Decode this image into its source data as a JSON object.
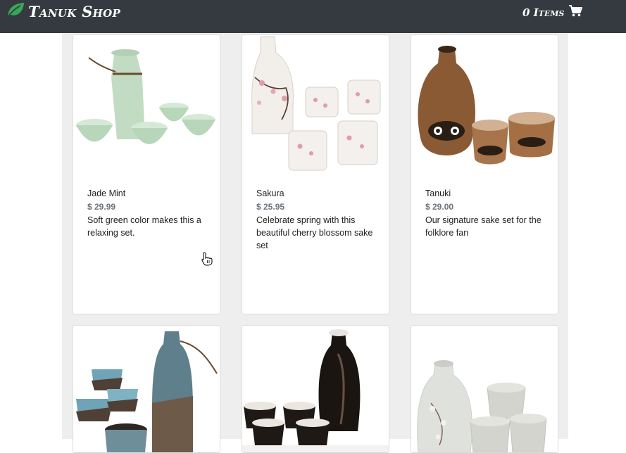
{
  "header": {
    "brand": "Tanuk Shop",
    "cart_label": "0 Items",
    "logo_icon": "leaf-icon",
    "cart_icon": "shopping-cart-icon",
    "background": "#343a40",
    "logo_color": "#3aa65a"
  },
  "products": [
    {
      "name": "Jade Mint",
      "price": "$ 29.99",
      "description": "Soft green color makes this a relaxing set."
    },
    {
      "name": "Sakura",
      "price": "$ 25.95",
      "description": "Celebrate spring with this beautiful cherry blossom sake set"
    },
    {
      "name": "Tanuki",
      "price": "$ 29.00",
      "description": "Our signature sake set for the folklore fan"
    },
    {
      "name": "",
      "price": "",
      "description": ""
    },
    {
      "name": "",
      "price": "",
      "description": ""
    },
    {
      "name": "",
      "price": "",
      "description": ""
    }
  ]
}
